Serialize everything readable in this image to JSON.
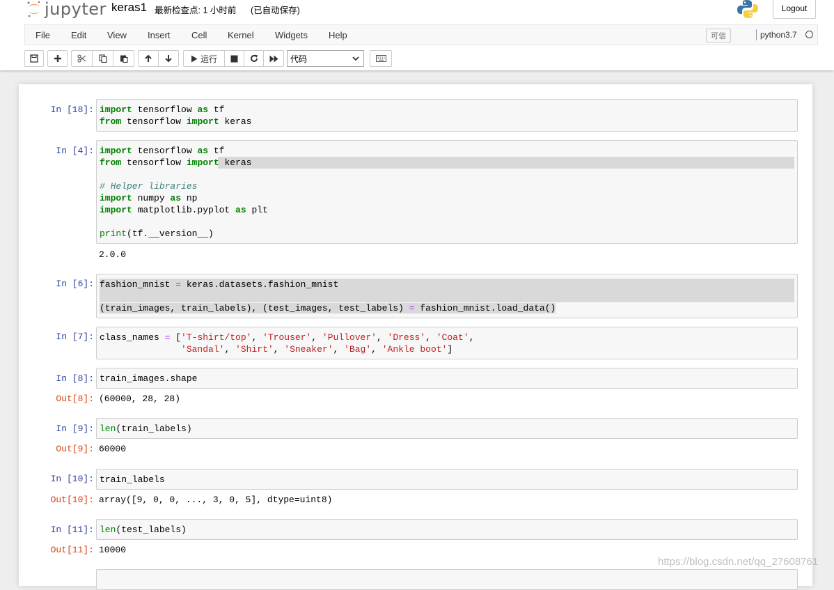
{
  "header": {
    "logo_text": "jupyter",
    "notebook_name": "keras1",
    "checkpoint": "最新检查点: 1 小时前",
    "autosave": "(已自动保存)",
    "logout_label": "Logout"
  },
  "menubar": {
    "items": [
      "File",
      "Edit",
      "View",
      "Insert",
      "Cell",
      "Kernel",
      "Widgets",
      "Help"
    ],
    "trusted": "可信",
    "kernel_name": "python3.7"
  },
  "toolbar": {
    "run_label": "运行",
    "cell_type": "代码"
  },
  "cells": [
    {
      "prompt": "In  [18]:",
      "lines": [
        "import tensorflow as tf",
        "from tensorflow import keras"
      ]
    },
    {
      "prompt": "In  [4]:",
      "lines": [
        "import tensorflow as tf",
        "from tensorflow import keras",
        "",
        "# Helper libraries",
        "import numpy as np",
        "import matplotlib.pyplot as plt",
        "",
        "print(tf.__version__)"
      ],
      "output": "2.0.0"
    },
    {
      "prompt": "In  [6]:",
      "lines": [
        "fashion_mnist = keras.datasets.fashion_mnist",
        "",
        "(train_images, train_labels), (test_images, test_labels) = fashion_mnist.load_data()"
      ]
    },
    {
      "prompt": "In  [7]:",
      "lines": [
        "class_names = ['T-shirt/top', 'Trouser', 'Pullover', 'Dress', 'Coat',",
        "               'Sandal', 'Shirt', 'Sneaker', 'Bag', 'Ankle boot']"
      ]
    },
    {
      "prompt": "In  [8]:",
      "lines": [
        "train_images.shape"
      ],
      "out_prompt": "Out[8]:",
      "output": "(60000, 28, 28)"
    },
    {
      "prompt": "In  [9]:",
      "lines": [
        "len(train_labels)"
      ],
      "out_prompt": "Out[9]:",
      "output": "60000"
    },
    {
      "prompt": "In  [10]:",
      "lines": [
        "train_labels"
      ],
      "out_prompt": "Out[10]:",
      "output": "array([9, 0, 0, ..., 3, 0, 5], dtype=uint8)"
    },
    {
      "prompt": "In  [11]:",
      "lines": [
        "len(test_labels)"
      ],
      "out_prompt": "Out[11]:",
      "output": "10000"
    }
  ],
  "watermark": "https://blog.csdn.net/qq_27608761",
  "icons": [
    "save-icon",
    "plus-icon",
    "cut-icon",
    "copy-icon",
    "paste-icon",
    "arrow-up-icon",
    "arrow-down-icon",
    "run-icon",
    "stop-icon",
    "restart-icon",
    "fast-forward-icon",
    "keyboard-icon",
    "python-logo-icon",
    "jupyter-logo-icon"
  ]
}
